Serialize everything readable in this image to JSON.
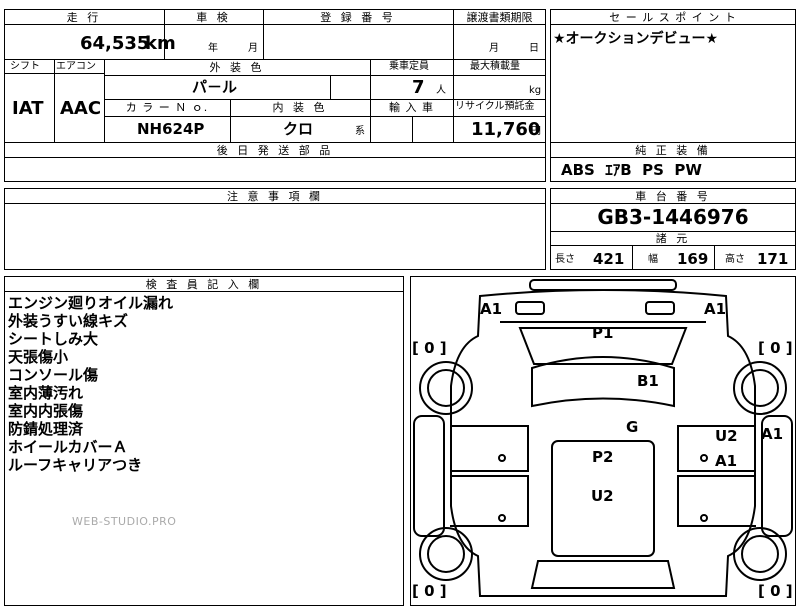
{
  "headers": {
    "mileage": "走 行",
    "inspection": "車 検",
    "registration_number": "登 録 番 号",
    "transfer_deadline": "譲渡書類期限",
    "sales_point": "セ ー ル ス ポ イ ン ト",
    "shift": "シフト",
    "aircon": "エアコン",
    "exterior_color": "外 装 色",
    "capacity": "乗車定員",
    "max_load": "最大積載量",
    "color_no": "カ ラ ー Ｎ ｏ.",
    "interior_color": "内 装 色",
    "import": "輸 入 車",
    "recycle": "リサイクル預託金",
    "later_parts": "後 日 発 送 部 品",
    "genuine_equipment": "純 正 装 備",
    "notes": "注 意 事 項 欄",
    "chassis_number": "車 台 番 号",
    "specs": "諸 元",
    "inspector_notes": "検 査 員 記 入 欄"
  },
  "values": {
    "mileage": "64,535",
    "mileage_unit": "km",
    "inspection_year": "年",
    "inspection_month": "月",
    "transfer_month": "月",
    "transfer_day": "日",
    "sales_point": "★オークションデビュー★",
    "shift": "IAT",
    "aircon": "AAC",
    "exterior_color": "パ－ル",
    "capacity": "7",
    "capacity_unit": "人",
    "max_load_unit": "kg",
    "color_no": "NH624P",
    "interior_color": "クロ",
    "interior_suffix": "系",
    "recycle": "11,760",
    "recycle_unit": "円",
    "genuine_equipment": "ABS  ｴｱB  PS  PW",
    "chassis_number": "GB3-1446976"
  },
  "specs": {
    "length_label": "長さ",
    "length": "421",
    "width_label": "幅",
    "width": "169",
    "height_label": "高さ",
    "height": "171"
  },
  "inspector_notes": [
    "エンジン廻りオイル漏れ",
    "外装うすい線キズ",
    "シートしみ大",
    "天張傷小",
    "コンソール傷",
    "室内薄汚れ",
    "室内内張傷",
    "防錆処理済",
    "ホイールカバーＡ",
    "ルーフキャリアつき"
  ],
  "watermark": "WEB-STUDIO.PRO",
  "diagram": {
    "a1_left": "A1",
    "a1_right": "A1",
    "p1": "P1",
    "b1": "B1",
    "g": "G",
    "p2": "P2",
    "u2_center": "U2",
    "u2_right": "U2",
    "a1_door": "A1",
    "a1_edge": "A1",
    "tire_fl": "[ 0 ]",
    "tire_fr": "[ 0 ]",
    "tire_rl": "[ 0 ]",
    "tire_rr": "[ 0 ]"
  }
}
